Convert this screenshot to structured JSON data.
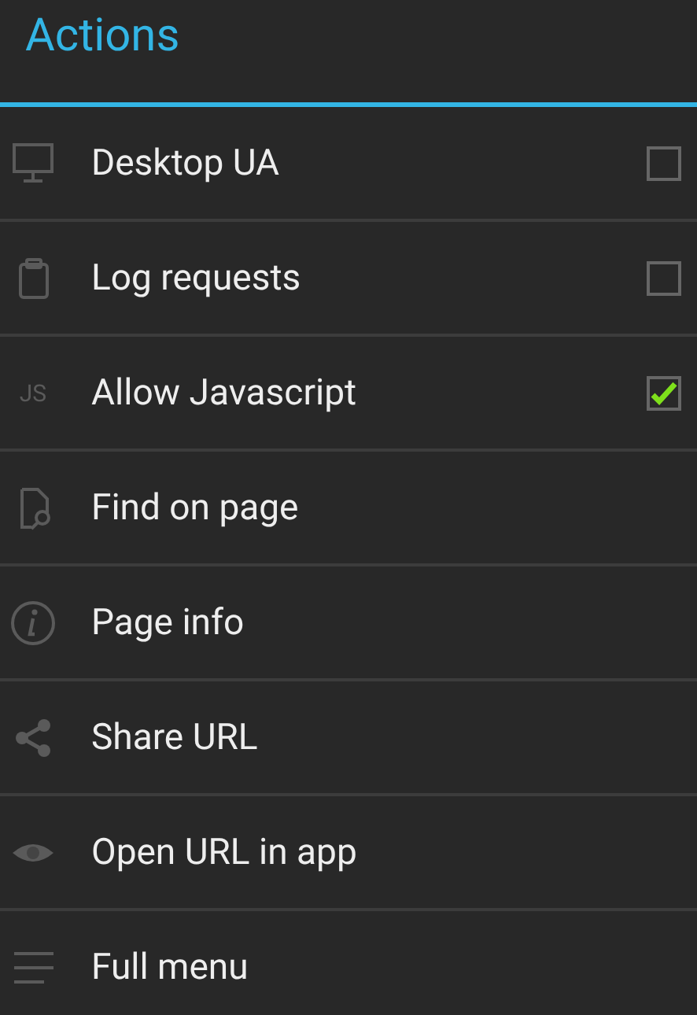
{
  "title": "Actions",
  "items": [
    {
      "kind": "toggle",
      "label": "Desktop UA",
      "checked": false
    },
    {
      "kind": "toggle",
      "label": "Log requests",
      "checked": false
    },
    {
      "kind": "toggle",
      "label": "Allow Javascript",
      "checked": true,
      "icon_text": "JS"
    },
    {
      "kind": "action",
      "label": "Find on page"
    },
    {
      "kind": "action",
      "label": "Page info"
    },
    {
      "kind": "action",
      "label": "Share URL"
    },
    {
      "kind": "action",
      "label": "Open URL in app"
    },
    {
      "kind": "action",
      "label": "Full menu"
    }
  ]
}
